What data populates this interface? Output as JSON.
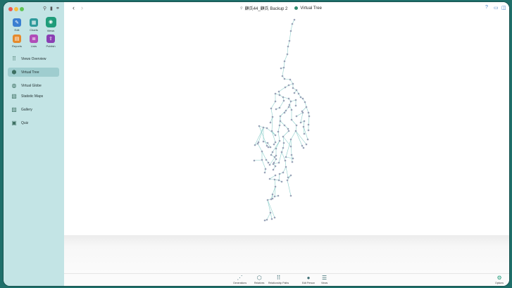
{
  "window": {
    "title": "顧氏44_顧氏 Backup 2",
    "view_title": "Virtual Tree"
  },
  "toolbar_grid": [
    {
      "id": "edit",
      "label": "Edit",
      "color": "#3b7fd1",
      "glyph": "✎"
    },
    {
      "id": "charts",
      "label": "Charts",
      "color": "#2e9a9b",
      "glyph": "▦"
    },
    {
      "id": "views",
      "label": "Views",
      "color": "#1f9c7a",
      "glyph": "◉"
    },
    {
      "id": "reports",
      "label": "Reports",
      "color": "#e58a2c",
      "glyph": "▤"
    },
    {
      "id": "lists",
      "label": "Lists",
      "color": "#b04db8",
      "glyph": "≣"
    },
    {
      "id": "publish",
      "label": "Publish",
      "color": "#8a3fb4",
      "glyph": "⇪"
    }
  ],
  "sidebar": {
    "items": [
      {
        "id": "views-overview",
        "label": "Views Overview",
        "icon": "grid-icon"
      },
      {
        "id": "virtual-tree",
        "label": "Virtual Tree",
        "icon": "tree-icon"
      },
      {
        "id": "virtual-globe",
        "label": "Virtual Globe",
        "icon": "globe-icon"
      },
      {
        "id": "statistic-maps",
        "label": "Statistic Maps",
        "icon": "map-icon"
      },
      {
        "id": "gallery",
        "label": "Gallery",
        "icon": "gallery-icon"
      },
      {
        "id": "quiz",
        "label": "Quiz",
        "icon": "quiz-icon"
      }
    ],
    "selected": "virtual-tree"
  },
  "bottom_bar": {
    "buttons": [
      {
        "id": "generations",
        "label": "Generations"
      },
      {
        "id": "relatives",
        "label": "Relatives"
      },
      {
        "id": "relationship-paths",
        "label": "Relationship Paths"
      },
      {
        "id": "edit-person",
        "label": "Edit Person"
      },
      {
        "id": "views",
        "label": "Views"
      },
      {
        "id": "options",
        "label": "Options"
      }
    ]
  },
  "colors": {
    "sidebar_bg": "#c3e4e5",
    "selection": "#9fcdcf",
    "accent": "#2f8a6e",
    "tree_line": "#8fd0cc",
    "tree_node": "#9aa3b8"
  }
}
